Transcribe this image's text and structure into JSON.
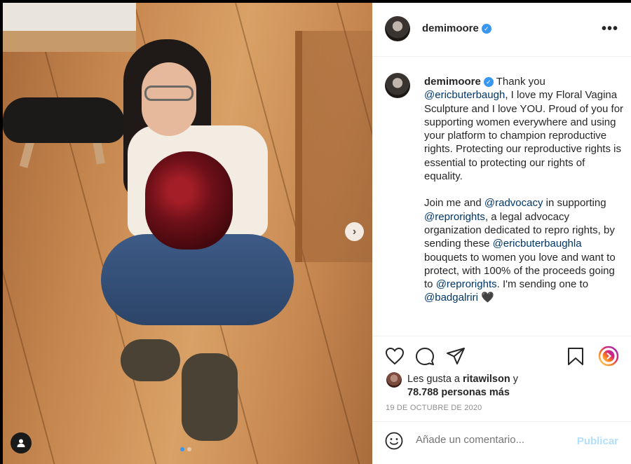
{
  "post": {
    "username": "demimoore",
    "verified": true,
    "verified_glyph": "✓",
    "more_glyph": "•••",
    "caption": {
      "p1_text": "Thank you",
      "p1_mention": "@ericbuterbaugh",
      "p1_rest": ", I love my Floral Vagina Sculpture and I love YOU. Proud of you for supporting women everywhere and using your platform to champion reproductive rights. Protecting our reproductive rights is essential to protecting our rights of equality.",
      "p2_a": "Join me and",
      "p2_m1": "@radvocacy",
      "p2_b": "in supporting",
      "p2_m2": "@reprorights",
      "p2_c": ", a legal advocacy organization dedicated to repro rights, by sending these",
      "p2_m3": "@ericbuterbaughla",
      "p2_d": "bouquets to women you love and want to protect, with 100% of the proceeds going to",
      "p2_m4": "@reprorights",
      "p2_e": ". I'm sending one to",
      "p2_m5": "@badgalriri",
      "p2_heart": "🖤"
    },
    "likes": {
      "prefix": "Les gusta a",
      "user": "ritawilson",
      "conj": "y",
      "count_text": "78.788 personas más"
    },
    "date": "19 DE OCTUBRE DE 2020",
    "comment": {
      "placeholder": "Añade un comentario...",
      "publish_label": "Publicar"
    }
  },
  "carousel": {
    "next_glyph": "›",
    "current_index": 1,
    "total": 2
  },
  "colors": {
    "link": "#00376b",
    "verified": "#3897f0",
    "publish_disabled": "#b2dffc",
    "muted": "#8e8e8e"
  },
  "icons": [
    "user-tag-icon",
    "chevron-right-icon",
    "heart-icon",
    "comment-icon",
    "share-icon",
    "bookmark-icon",
    "reels-icon",
    "emoji-icon",
    "verified-icon",
    "more-icon"
  ]
}
